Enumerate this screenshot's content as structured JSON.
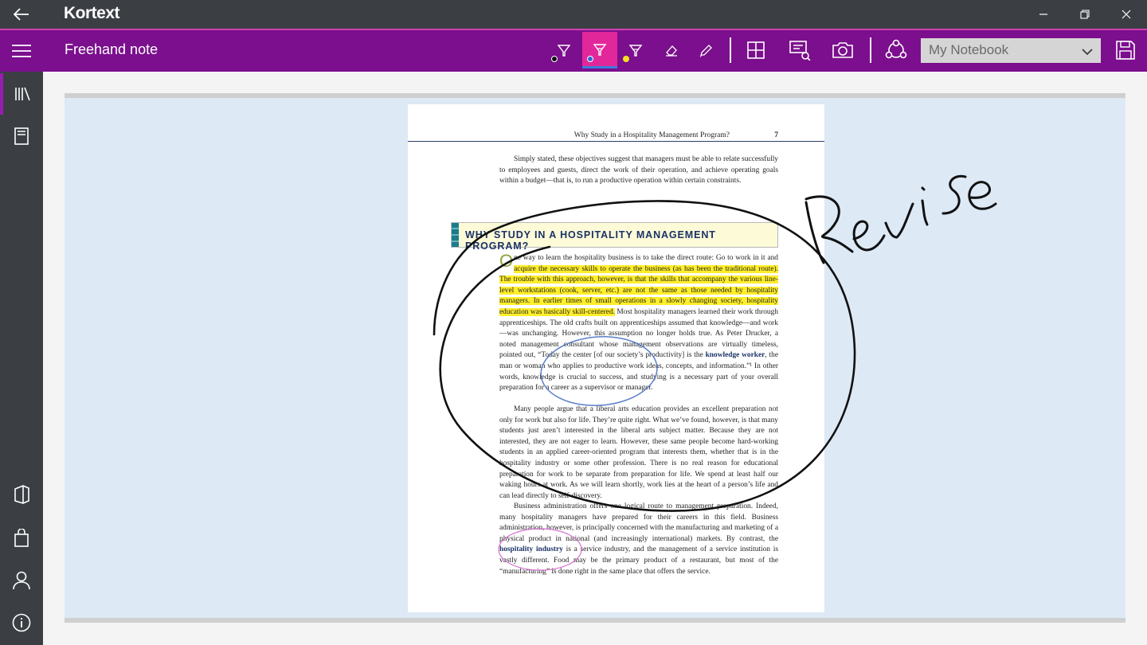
{
  "app": {
    "name": "Kortext"
  },
  "toolbar": {
    "title": "Freehand note",
    "notebook_selected": "My Notebook",
    "tools": [
      "pen-black",
      "highlighter-blue",
      "highlighter-yellow",
      "eraser",
      "ruler",
      "grid",
      "screenshot",
      "camera",
      "share",
      "save"
    ],
    "accent": "#7b0f8d",
    "active_tool_color": "#e2279b"
  },
  "sidebar": {
    "items": [
      "library",
      "book",
      "office",
      "store",
      "account",
      "info"
    ]
  },
  "page": {
    "header_title": "Why Study in a Hospitality Management Program?",
    "page_number": "7",
    "intro": "Simply stated, these objectives suggest that managers must be able to relate successfully to employees and guests, direct the work of their operation, and achieve operating goals within a budget—that is, to run a productive operation within certain constraints.",
    "heading": "WHY STUDY IN A HOSPITALITY MANAGEMENT PROGRAM?",
    "p1_dropcap": "O",
    "p1_a": "ne way to learn the hospitality business is to take the direct route: Go to work in it and ",
    "p1_hl": "acquire the necessary skills to operate the business (as has been the traditional route). The trouble with this approach, however, is that the skills that accompany the various line-level workstations (cook, server, etc.) are not the same as those needed by hospitality managers. In earlier times of small operations in a slowly changing society, hospitality education was basically skill-centered.",
    "p1_b": " Most hospitality managers learned their work through apprenticeships. The old crafts built on apprenticeships assumed that knowledge—and work—was unchanging. However, this assumption no longer holds true. As Peter Drucker, a noted management consultant whose management observations are virtually timeless, pointed out, “Today the center [of our society’s productivity] is the ",
    "p1_kw": "knowledge worker",
    "p1_c": ", the man or woman who applies to productive work ideas, concepts, and information.”¹ In other words, knowledge is crucial to success, and studying is a necessary part of your overall preparation for a career as a supervisor or manager.",
    "p2": "Many people argue that a liberal arts education provides an excellent preparation not only for work but also for life. They’re quite right. What we’ve found, however, is that many students just aren’t interested in the liberal arts subject matter. Because they are not interested, they are not eager to learn. However, these same people become hard-working students in an applied career-oriented program that interests them, whether that is in the hospitality industry or some other profession. There is no real reason for educational preparation for work to be separate from preparation for life. We spend at least half our waking hours at work. As we will learn shortly, work lies at the heart of a person’s life and can lead directly to self-discovery.",
    "p3_a": "Business administration offers one logical route to management preparation. Indeed, many hospitality managers have prepared for their careers in this field. Business administration, however, is principally concerned with the manufacturing and marketing of a physical product in national (and increasingly international) markets. By contrast, the ",
    "p3_kw": "hospitality industry",
    "p3_b": " is a service industry, and the management of a service institution is vastly different. Food may be the primary product of a restaurant, but most of the “manufacturing” is done right in the same place that offers the service."
  },
  "annotation": {
    "handwritten_text": "Revise"
  }
}
